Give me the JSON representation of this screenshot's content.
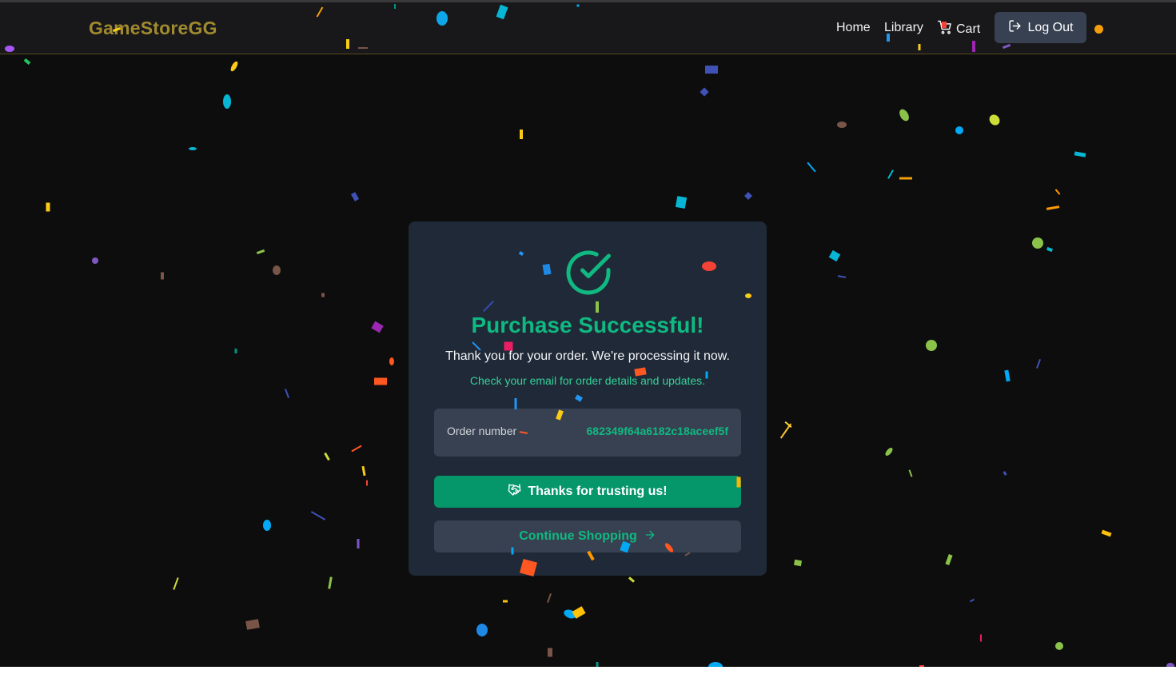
{
  "navbar": {
    "brand": "GameStoreGG",
    "links": {
      "home": "Home",
      "library": "Library",
      "cart": "Cart"
    },
    "logout_label": "Log Out",
    "status_dot_color": "#f59e0b"
  },
  "card": {
    "icon": "check-circle-icon",
    "title": "Purchase Successful!",
    "subtitle": "Thank you for your order. We're processing it now.",
    "hint": "Check your email for order details and updates.",
    "order_label": "Order number",
    "order_number": "682349f64a6182c18aceef5f",
    "thanks_label": "Thanks for trusting us!",
    "continue_label": "Continue Shopping"
  },
  "colors": {
    "accent": "#10b981",
    "brand": "#a08a2e",
    "background": "#0d0d0d",
    "card": "#1f2937"
  }
}
